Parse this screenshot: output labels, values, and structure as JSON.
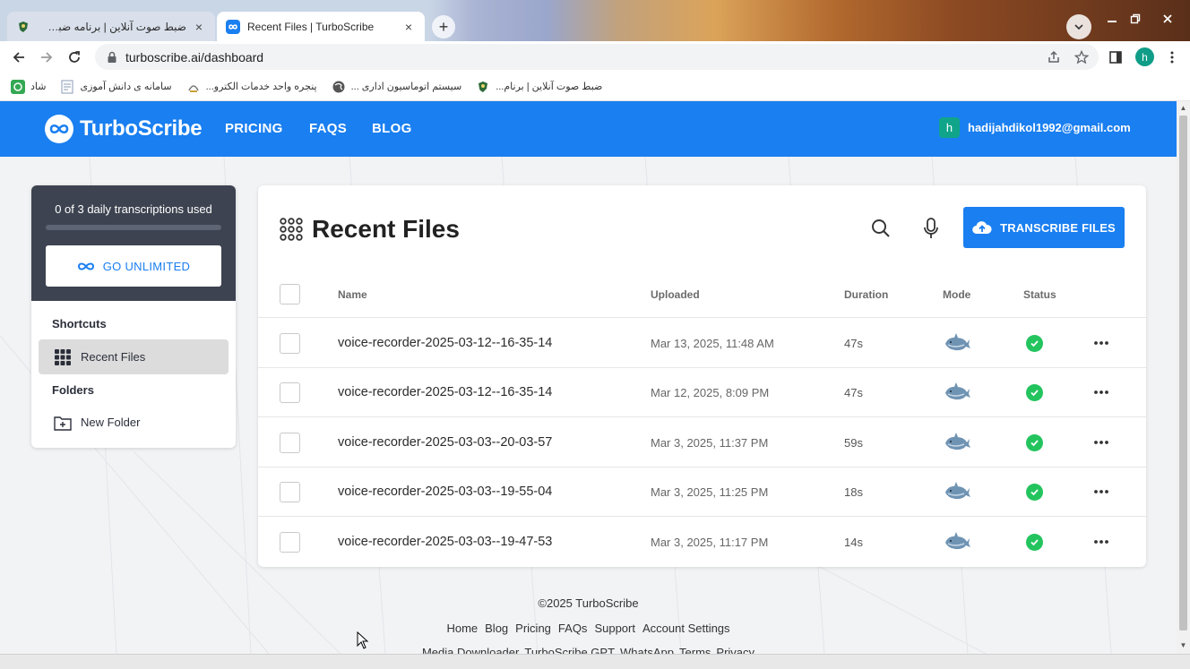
{
  "browser": {
    "tabs": [
      {
        "title": "ضبط صوت آنلاین | برنامه ضبط صدا رایگ",
        "active": false
      },
      {
        "title": "Recent Files | TurboScribe",
        "active": true
      }
    ],
    "tab_close": "×",
    "new_tab": "+",
    "url": "turboscribe.ai/dashboard",
    "profile_initial": "h",
    "bookmarks": [
      {
        "label": "شاد"
      },
      {
        "label": "سامانه ی دانش آموزی"
      },
      {
        "label": "پنجره واحد خدمات الکترو..."
      },
      {
        "label": "سیستم اتوماسیون اداری ..."
      },
      {
        "label": "ضبط صوت آنلاین | برنام..."
      }
    ]
  },
  "site": {
    "brand": "TurboScribe",
    "nav": [
      "PRICING",
      "FAQS",
      "BLOG"
    ],
    "account_initial": "h",
    "account_email": "hadijahdikol1992@gmail.com",
    "accent_color": "#1a7ff0"
  },
  "sidebar": {
    "usage_text": "0 of 3 daily transcriptions used",
    "usage_fraction": 0,
    "go_unlimited": "GO UNLIMITED",
    "shortcuts_heading": "Shortcuts",
    "recent_files": "Recent Files",
    "folders_heading": "Folders",
    "new_folder": "New Folder"
  },
  "main": {
    "title": "Recent Files",
    "transcribe_button": "TRANSCRIBE FILES",
    "columns": {
      "name": "Name",
      "uploaded": "Uploaded",
      "duration": "Duration",
      "mode": "Mode",
      "status": "Status"
    },
    "rows": [
      {
        "name": "voice-recorder-2025-03-12--16-35-14",
        "uploaded": "Mar 13, 2025, 11:48 AM",
        "duration": "47s",
        "mode": "whale-icon",
        "status": "completed"
      },
      {
        "name": "voice-recorder-2025-03-12--16-35-14",
        "uploaded": "Mar 12, 2025, 8:09 PM",
        "duration": "47s",
        "mode": "whale-icon",
        "status": "completed"
      },
      {
        "name": "voice-recorder-2025-03-03--20-03-57",
        "uploaded": "Mar 3, 2025, 11:37 PM",
        "duration": "59s",
        "mode": "whale-icon",
        "status": "completed"
      },
      {
        "name": "voice-recorder-2025-03-03--19-55-04",
        "uploaded": "Mar 3, 2025, 11:25 PM",
        "duration": "18s",
        "mode": "whale-icon",
        "status": "completed"
      },
      {
        "name": "voice-recorder-2025-03-03--19-47-53",
        "uploaded": "Mar 3, 2025, 11:17 PM",
        "duration": "14s",
        "mode": "whale-icon",
        "status": "completed"
      }
    ]
  },
  "footer": {
    "copyright": "©2025 TurboScribe",
    "links": [
      "Home",
      "Blog",
      "Pricing",
      "FAQs",
      "Support",
      "Account Settings"
    ],
    "links2": [
      "Media Downloader",
      "TurboScribe GPT",
      "WhatsApp",
      "Terms",
      "Privacy"
    ]
  }
}
